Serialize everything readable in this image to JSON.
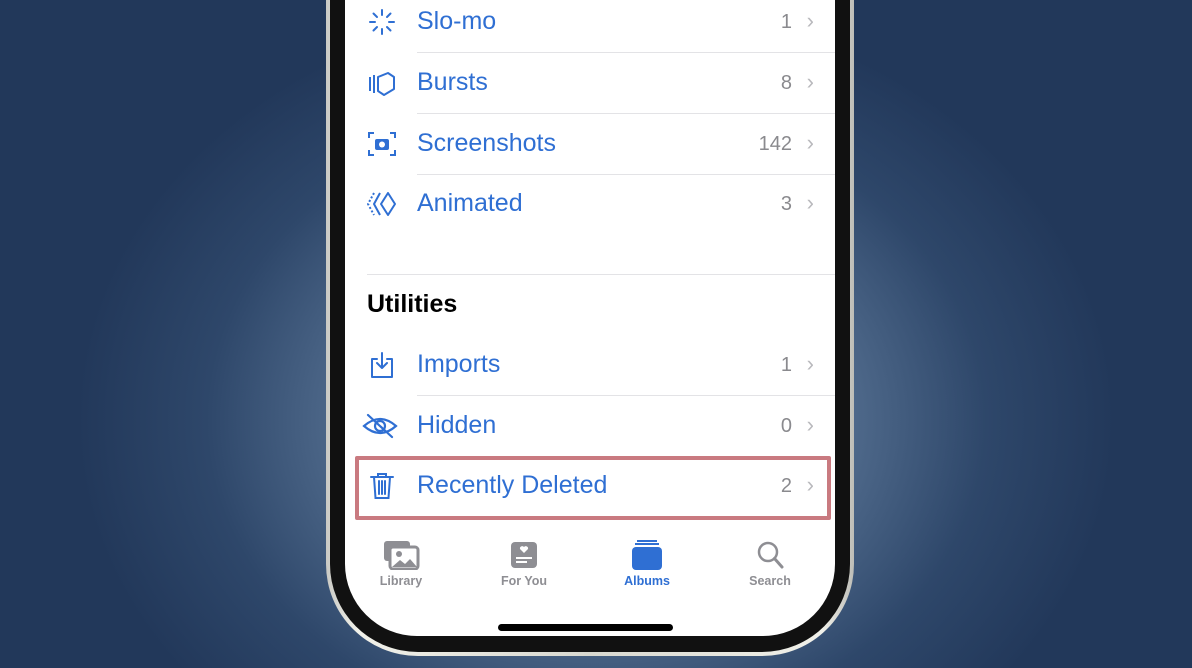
{
  "media_types": [
    {
      "label": "Slo-mo",
      "count": "1",
      "icon": "slomo-icon"
    },
    {
      "label": "Bursts",
      "count": "8",
      "icon": "bursts-icon"
    },
    {
      "label": "Screenshots",
      "count": "142",
      "icon": "screenshot-icon"
    },
    {
      "label": "Animated",
      "count": "3",
      "icon": "animated-icon"
    }
  ],
  "utilities": {
    "title": "Utilities",
    "items": [
      {
        "label": "Imports",
        "count": "1",
        "icon": "import-icon"
      },
      {
        "label": "Hidden",
        "count": "0",
        "icon": "eye-slash-icon"
      },
      {
        "label": "Recently Deleted",
        "count": "2",
        "icon": "trash-icon",
        "highlighted": true
      }
    ]
  },
  "chevron": "›",
  "tabs": [
    {
      "label": "Library",
      "active": false
    },
    {
      "label": "For You",
      "active": false
    },
    {
      "label": "Albums",
      "active": true
    },
    {
      "label": "Search",
      "active": false
    }
  ],
  "colors": {
    "accent": "#2f6fd3",
    "highlight": "#c97a80",
    "inactive": "#8e8e93"
  }
}
